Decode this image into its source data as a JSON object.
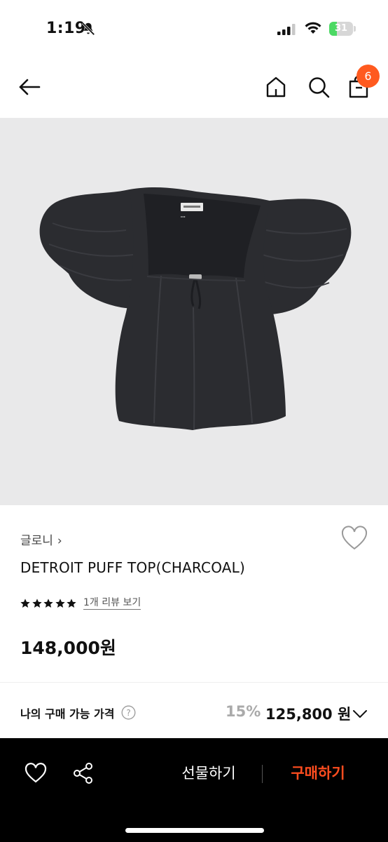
{
  "status_bar": {
    "time": "1:19",
    "battery": "31",
    "battery_level": 0.31,
    "icons": [
      "bell-slash-icon",
      "signal-icon",
      "wifi-icon",
      "battery-icon"
    ]
  },
  "header": {
    "icons": [
      "back-arrow-icon",
      "home-icon",
      "search-icon",
      "shopping-bag-icon"
    ],
    "cart_count": "6"
  },
  "product": {
    "brand": "글로니",
    "brand_chevron": "›",
    "name": "DETROIT PUFF TOP(CHARCOAL)",
    "rating_stars": 5,
    "review_link": "1개 리뷰 보기",
    "price": "148,000원"
  },
  "my_price": {
    "label": "나의 구매 가능 가격",
    "discount_rate": "15%",
    "discount_price": "125,800 원"
  },
  "bottom_bar": {
    "gift_label": "선물하기",
    "buy_label": "구매하기"
  },
  "colors": {
    "accent": "#ff5a1f",
    "buy_text": "#ff4d1f",
    "image_bg": "#e9e9ea",
    "garment": "#2b2c30"
  }
}
